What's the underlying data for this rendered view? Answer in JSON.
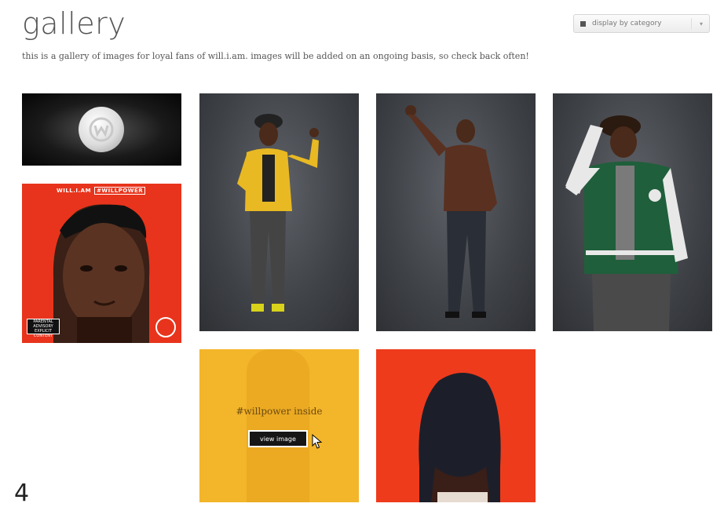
{
  "header": {
    "title": "gallery",
    "subtitle": "this is a gallery of images for loyal fans of will.i.am. images will be added on an ongoing basis, so check back often!"
  },
  "filter": {
    "label": "display by category",
    "icon": "grid-icon"
  },
  "album": {
    "artist": "WILL.I.AM",
    "title": "#WILLPOWER",
    "advisory": "PARENTAL ADVISORY EXPLICIT CONTENT"
  },
  "promo": {
    "caption": "#willpower inside",
    "button_label": "view image"
  },
  "colors": {
    "album_red": "#e8341c",
    "promo_yellow": "#f3b52a",
    "red_tile": "#ee3b1c",
    "jacket_yellow": "#e8b923",
    "varsity_green": "#1f5f3b"
  },
  "footer": {
    "page_number": "4"
  }
}
